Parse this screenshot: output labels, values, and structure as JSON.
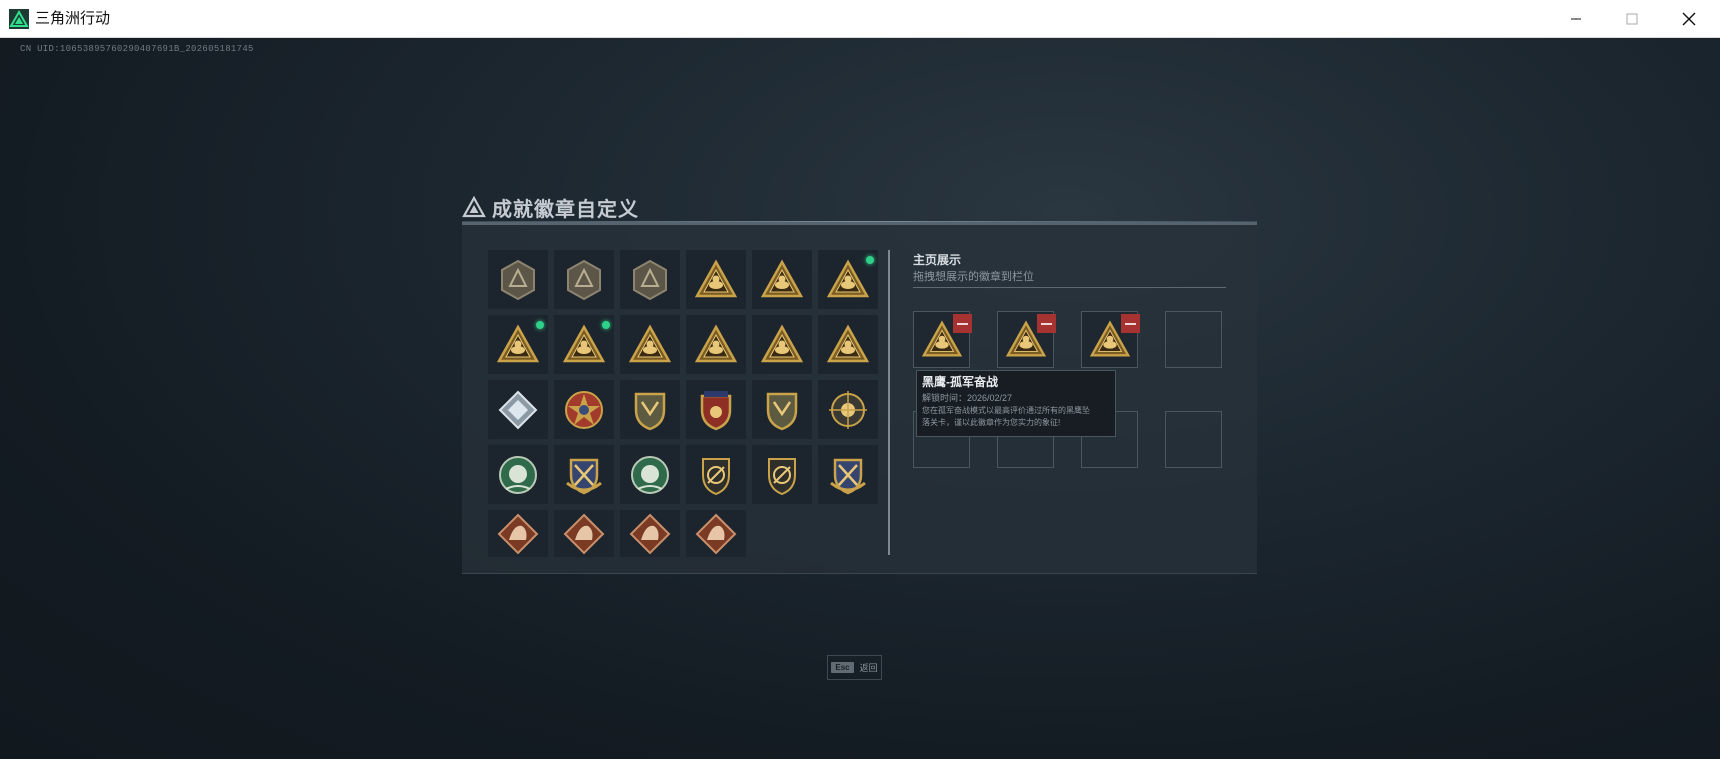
{
  "window": {
    "title": "三角洲行动",
    "minimize_icon": "minimize-icon",
    "maximize_icon": "maximize-icon",
    "close_icon": "close-icon"
  },
  "uid_text": "CN UID:10653895760290407691B_202605181745",
  "panel": {
    "title": "成就徽章自定义",
    "title_icon": "delta-triangle-icon"
  },
  "badges": [
    {
      "icon": "delta-shield-badge-icon",
      "row": 0,
      "col": 0,
      "new": false,
      "style": "gray-hex"
    },
    {
      "icon": "helicopter-badge-icon",
      "row": 0,
      "col": 1,
      "new": false,
      "style": "gray-hex"
    },
    {
      "icon": "arrow-shield-badge-icon",
      "row": 0,
      "col": 2,
      "new": false,
      "style": "gray-hex"
    },
    {
      "icon": "triangle-emblem-badge-icon",
      "row": 0,
      "col": 3,
      "new": false,
      "style": "gold-tri"
    },
    {
      "icon": "triangle-hand-badge-icon",
      "row": 0,
      "col": 4,
      "new": false,
      "style": "gold-tri"
    },
    {
      "icon": "triangle-tank-badge-icon",
      "row": 0,
      "col": 5,
      "new": true,
      "style": "gold-tri"
    },
    {
      "icon": "triangle-soldier-badge-icon",
      "row": 1,
      "col": 0,
      "new": true,
      "style": "gold-tri"
    },
    {
      "icon": "triangle-bri-badge-icon",
      "row": 1,
      "col": 1,
      "new": true,
      "style": "gold-tri"
    },
    {
      "icon": "triangle-helmet-badge-icon",
      "row": 1,
      "col": 2,
      "new": false,
      "style": "gold-tri"
    },
    {
      "icon": "triangle-number-one-badge-icon",
      "row": 1,
      "col": 3,
      "new": false,
      "style": "gold-tri"
    },
    {
      "icon": "triangle-tower-badge-icon",
      "row": 1,
      "col": 4,
      "new": false,
      "style": "gold-tri"
    },
    {
      "icon": "triangle-figure-badge-icon",
      "row": 1,
      "col": 5,
      "new": false,
      "style": "gold-tri"
    },
    {
      "icon": "silver-diamond-badge-icon",
      "row": 2,
      "col": 0,
      "new": false,
      "style": "silver-diamond"
    },
    {
      "icon": "star-medal-badge-icon",
      "row": 2,
      "col": 1,
      "new": false,
      "style": "star-medal"
    },
    {
      "icon": "green-shield-badge-icon",
      "row": 2,
      "col": 2,
      "new": false,
      "style": "gold-shield"
    },
    {
      "icon": "starred-shield-badge-icon",
      "row": 2,
      "col": 3,
      "new": false,
      "style": "red-shield"
    },
    {
      "icon": "lion-shield-badge-icon",
      "row": 2,
      "col": 4,
      "new": false,
      "style": "gold-shield"
    },
    {
      "icon": "crosshair-badge-icon",
      "row": 2,
      "col": 5,
      "new": false,
      "style": "round-gold"
    },
    {
      "icon": "wreath-badge-icon",
      "row": 3,
      "col": 0,
      "new": false,
      "style": "green-round"
    },
    {
      "icon": "blue-crest-badge-icon",
      "row": 3,
      "col": 1,
      "new": false,
      "style": "blue-crest"
    },
    {
      "icon": "green-wreath-badge-icon",
      "row": 3,
      "col": 2,
      "new": false,
      "style": "green-round"
    },
    {
      "icon": "slash-shield-badge-icon",
      "row": 3,
      "col": 3,
      "new": false,
      "style": "dark-shield"
    },
    {
      "icon": "rifle-shield-badge-icon",
      "row": 3,
      "col": 4,
      "new": false,
      "style": "dark-shield"
    },
    {
      "icon": "crossed-crest-badge-icon",
      "row": 3,
      "col": 5,
      "new": false,
      "style": "blue-crest"
    },
    {
      "icon": "wolf-diamond-badge-icon",
      "row": 4,
      "col": 0,
      "new": false,
      "style": "bronze-diamond"
    },
    {
      "icon": "dragon-diamond-badge-icon",
      "row": 4,
      "col": 1,
      "new": false,
      "style": "bronze-diamond"
    },
    {
      "icon": "beast-diamond-badge-icon",
      "row": 4,
      "col": 2,
      "new": false,
      "style": "bronze-diamond"
    },
    {
      "icon": "eagle-diamond-badge-icon",
      "row": 4,
      "col": 3,
      "new": false,
      "style": "bronze-diamond"
    }
  ],
  "showcase": {
    "title": "主页展示",
    "subtitle": "拖拽想展示的徽章到栏位",
    "slots": [
      {
        "badge": "triangle-soldier-badge-icon",
        "removable": true
      },
      {
        "badge": "triangle-tank-badge-icon",
        "removable": true
      },
      {
        "badge": "triangle-bri-badge-icon",
        "removable": true
      },
      {
        "badge": null,
        "removable": false
      },
      {
        "badge": null,
        "removable": false
      },
      {
        "badge": null,
        "removable": false
      },
      {
        "badge": null,
        "removable": false
      },
      {
        "badge": null,
        "removable": false
      }
    ]
  },
  "tooltip": {
    "title": "黑鹰-孤军奋战",
    "time": "解锁时间：2026/02/27",
    "desc_line1": "您在孤军奋战模式以最高评价通过所有的黑鹰坠",
    "desc_line2": "落关卡，谨以此徽章作为您实力的象征!"
  },
  "footer": {
    "key": "Esc",
    "label": "返回"
  },
  "colors": {
    "accent_green": "#2fd08a",
    "gold": "#c9a24a",
    "remove_red": "#a63232",
    "logo_green": "#20c997"
  }
}
